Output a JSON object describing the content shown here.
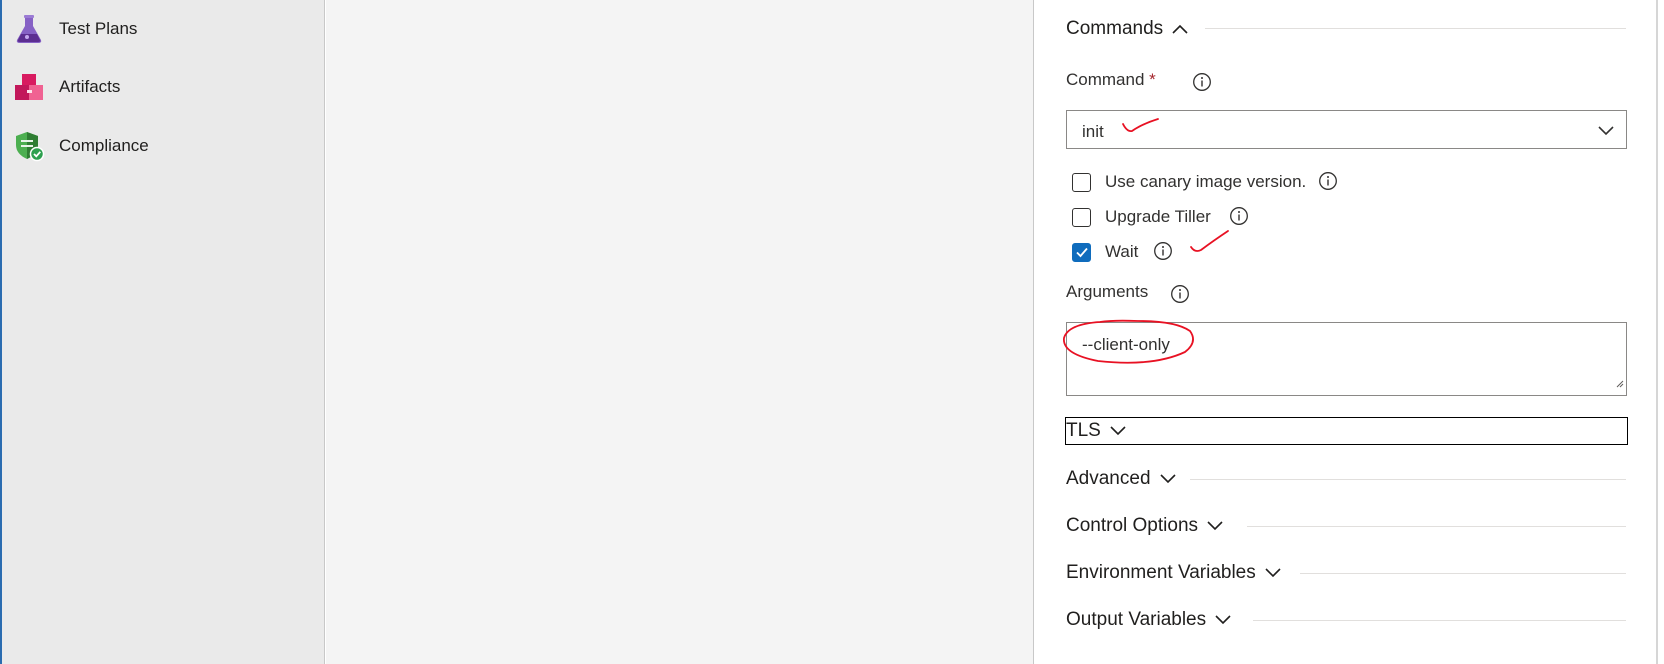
{
  "nav": {
    "items": [
      {
        "label": "Test Plans",
        "icon": "flask-icon",
        "color": "#8661c5"
      },
      {
        "label": "Artifacts",
        "icon": "package-icon",
        "color": "#c2185b"
      },
      {
        "label": "Compliance",
        "icon": "shield-check-icon",
        "color": "#2ea04f"
      }
    ]
  },
  "commands": {
    "title": "Commands",
    "command_label": "Command",
    "required_mark": "*",
    "command_value": "init",
    "options": [
      {
        "label": "Use canary image version.",
        "checked": false
      },
      {
        "label": "Upgrade Tiller",
        "checked": false
      },
      {
        "label": "Wait",
        "checked": true
      }
    ],
    "arguments_label": "Arguments",
    "arguments_value": "--client-only"
  },
  "sections": {
    "tls": "TLS",
    "advanced": "Advanced",
    "control_options": "Control Options",
    "environment_variables": "Environment Variables",
    "output_variables": "Output Variables"
  },
  "colors": {
    "accent": "#0f6cbd",
    "annotation": "#e81123"
  }
}
